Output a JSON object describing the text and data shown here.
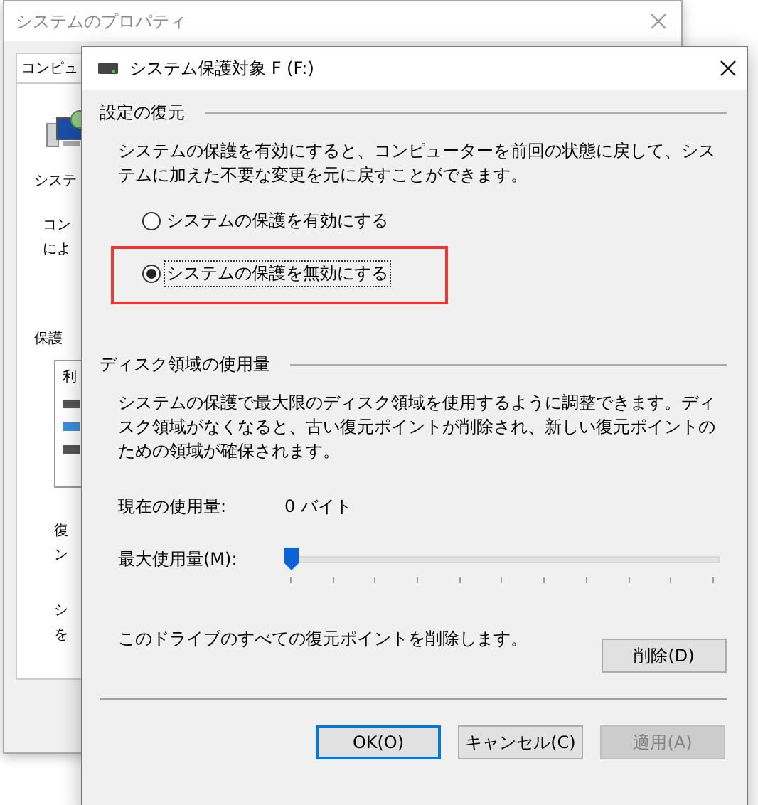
{
  "back_window": {
    "title": "システムのプロパティ",
    "tab": "コンピュ",
    "sections_above": [
      {
        "lines": [
          "システ"
        ]
      },
      {
        "lines": [
          "コン",
          "によ"
        ]
      },
      {
        "lines": [
          "保護"
        ]
      }
    ],
    "list_header": "利",
    "sections_below": [
      {
        "lines": [
          "復",
          "ン"
        ]
      },
      {
        "lines": [
          "シ",
          "を"
        ]
      }
    ]
  },
  "dialog": {
    "title": "システム保護対象 F (F:)",
    "restore_group": {
      "heading": "設定の復元",
      "description": "システムの保護を有効にすると、コンピューターを前回の状態に戻して、システムに加えた不要な変更を元に戻すことができます。",
      "options": [
        {
          "label": "システムの保護を有効にする",
          "selected": false,
          "focused": false,
          "highlighted": false
        },
        {
          "label": "システムの保護を無効にする",
          "selected": true,
          "focused": true,
          "highlighted": true
        }
      ]
    },
    "disk_group": {
      "heading": "ディスク領域の使用量",
      "description": "システムの保護で最大限のディスク領域を使用するように調整できます。ディスク領域がなくなると、古い復元ポイントが削除され、新しい復元ポイントのための領域が確保されます。",
      "current_label": "現在の使用量:",
      "current_value": "0 バイト",
      "max_label": "最大使用量(M):",
      "max_slider": {
        "level": 0
      },
      "delete_text": "このドライブのすべての復元ポイントを削除します。",
      "delete_button": "削除(D)"
    },
    "buttons": [
      {
        "label": "OK(O)",
        "kind": "default"
      },
      {
        "label": "キャンセル(C)",
        "kind": "normal"
      },
      {
        "label": "適用(A)",
        "kind": "disabled"
      }
    ]
  }
}
